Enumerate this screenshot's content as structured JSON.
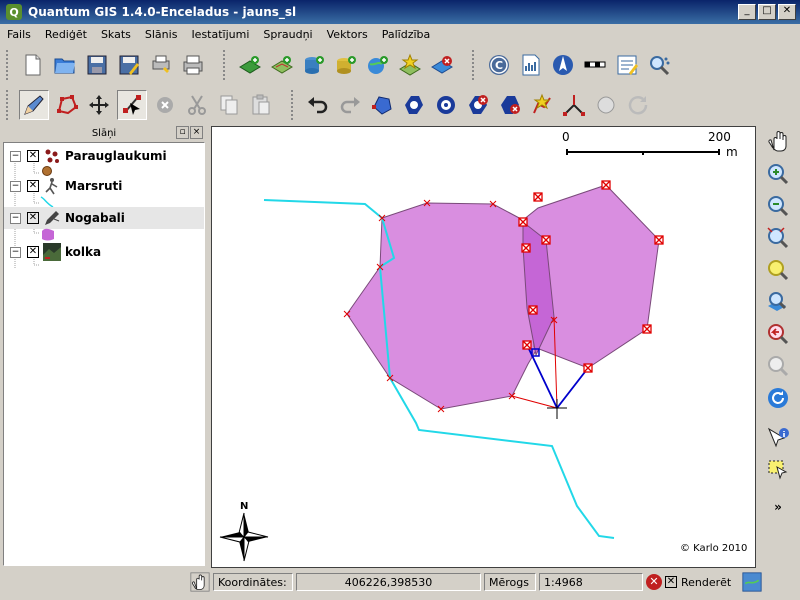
{
  "window": {
    "title": "Quantum GIS 1.4.0-Enceladus - jauns_sl",
    "app_icon": "Q",
    "min": "_",
    "max": "□",
    "close": "✕"
  },
  "menu": [
    "Fails",
    "Rediģēt",
    "Skats",
    "Slānis",
    "Iestatījumi",
    "Spraudņi",
    "Vektors",
    "Palīdzība"
  ],
  "toolbar1_icons": [
    "new-project-icon",
    "open-project-icon",
    "save-project-icon",
    "save-as-icon",
    "print-composer-icon",
    "print-icon",
    "add-raster-icon",
    "add-vector-icon",
    "add-postgis-icon",
    "add-spatialite-icon",
    "add-wms-icon",
    "new-vector-layer-icon",
    "remove-layer-icon",
    "copyright-icon",
    "wms-server-icon",
    "north-arrow-icon",
    "scalebar-icon",
    "georeferencer-icon",
    "zoom-map-tool-icon"
  ],
  "toolbar2_icons": [
    "toggle-editing-icon",
    "capture-polygon-icon",
    "move-feature-icon",
    "node-tool-icon",
    "delete-selected-icon",
    "cut-icon",
    "copy-icon",
    "paste-icon",
    "undo-icon",
    "redo-icon",
    "simplify-icon",
    "add-ring-icon",
    "add-island-icon",
    "delete-ring-icon",
    "delete-part-icon",
    "reshape-icon",
    "split-icon",
    "merge-icon",
    "rotate-icon"
  ],
  "layers_panel": {
    "title": "Slāņi",
    "layers": [
      {
        "name": "Parauglaukumi",
        "checked": "✕",
        "expander": "−",
        "selected": false
      },
      {
        "name": "Marsruti",
        "checked": "✕",
        "expander": "−",
        "selected": false
      },
      {
        "name": "Nogabali",
        "checked": "✕",
        "expander": "−",
        "selected": true
      },
      {
        "name": "kolka",
        "checked": "✕",
        "expander": "−",
        "selected": false
      }
    ]
  },
  "map": {
    "scalebar": {
      "start": "0",
      "end": "200",
      "unit": "m"
    },
    "north_label": "N",
    "copyright": "© Karlo 2010",
    "colors": {
      "polygon_fill": "#d98ee0",
      "polygon_stroke": "#7a4a7a",
      "selected_fill": "#c566d6",
      "route": "#22d8e8",
      "vertex": "#e00000",
      "rubber_band": "#0000cc"
    }
  },
  "right_toolbar_icons": [
    "pan-icon",
    "zoom-in-icon",
    "zoom-out-icon",
    "zoom-full-icon",
    "zoom-selection-icon",
    "zoom-layer-icon",
    "zoom-last-icon",
    "zoom-actual-icon",
    "refresh-icon",
    "identify-icon",
    "select-icon"
  ],
  "right_more": "»",
  "status": {
    "coord_label": "Koordinātes:",
    "coord_value": "406226,398530",
    "scale_label": "Mērogs",
    "scale_value": "1:4968",
    "render_label": "Renderēt",
    "render_check": "✕",
    "stop_icon": "✕"
  }
}
